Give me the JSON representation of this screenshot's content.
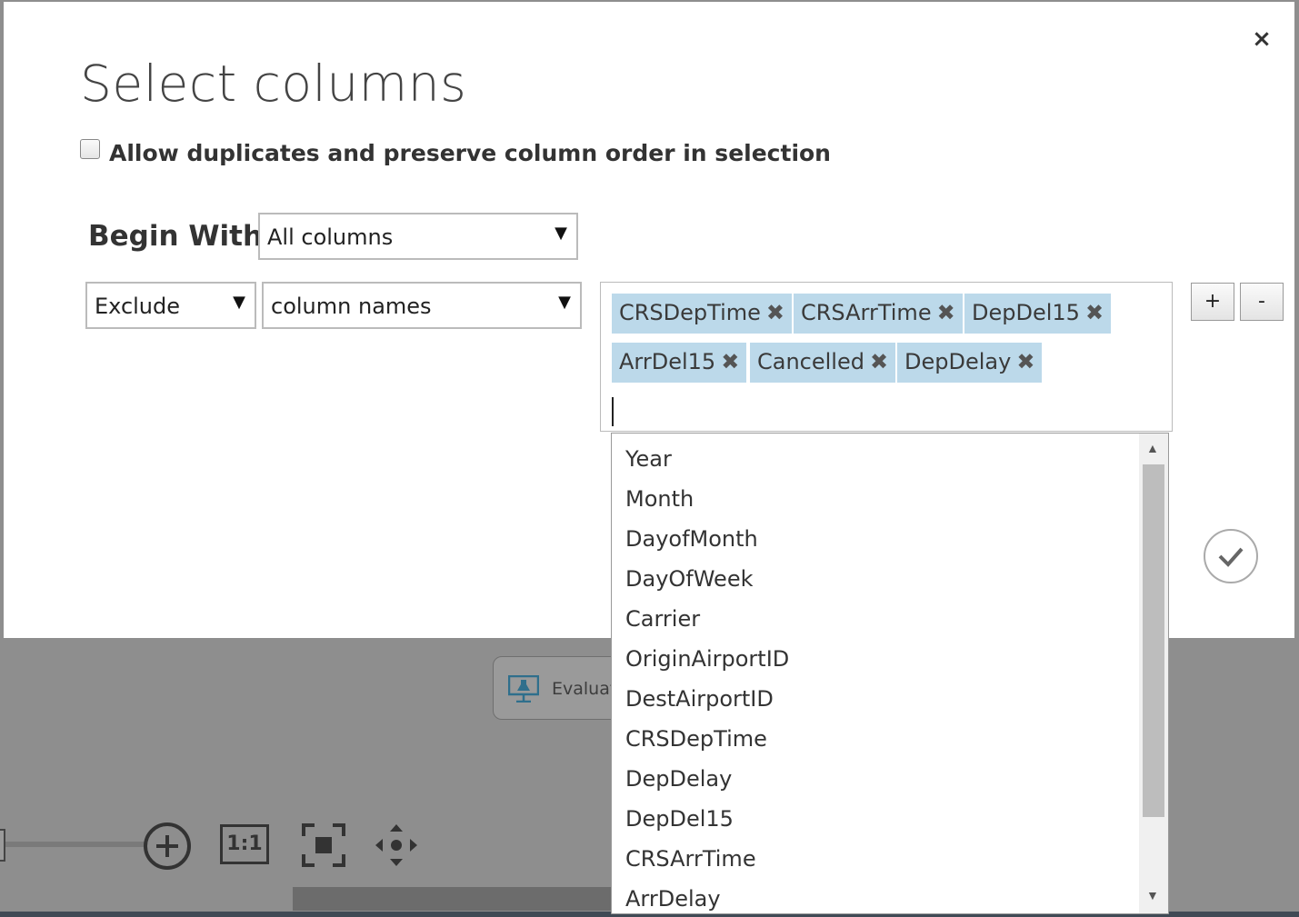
{
  "background": {
    "module_label": "Evaluate",
    "zoom_one_to_one": "1:1"
  },
  "dialog": {
    "close_glyph": "×",
    "title": "Select columns",
    "allow_duplicates_label": "Allow duplicates and preserve column order in selection",
    "allow_duplicates_checked": false,
    "begin_with_label": "Begin With",
    "begin_with_value": "All columns",
    "rule": {
      "mode_value": "Exclude",
      "type_value": "column names",
      "selected_tags": [
        "CRSDepTime",
        "CRSArrTime",
        "DepDel15",
        "ArrDel15",
        "Cancelled",
        "DepDelay"
      ],
      "tag_remove_glyph": "✖"
    },
    "add_rule_label": "+",
    "remove_rule_label": "-",
    "dropdown_arrow": "▼"
  },
  "dropdown": {
    "options": [
      "Year",
      "Month",
      "DayofMonth",
      "DayOfWeek",
      "Carrier",
      "OriginAirportID",
      "DestAirportID",
      "CRSDepTime",
      "DepDelay",
      "DepDel15",
      "CRSArrTime",
      "ArrDelay"
    ]
  },
  "colors": {
    "tag_background": "#bcd9ea",
    "overlay_gray": "#8e8e8e",
    "dialog_background": "#ffffff"
  },
  "icons": {
    "close": "close-icon",
    "checkmark": "checkmark-icon",
    "zoom_in": "zoom-in-icon",
    "fit": "fit-to-screen-icon",
    "pan": "pan-icon",
    "module": "experiment-flask-icon"
  }
}
